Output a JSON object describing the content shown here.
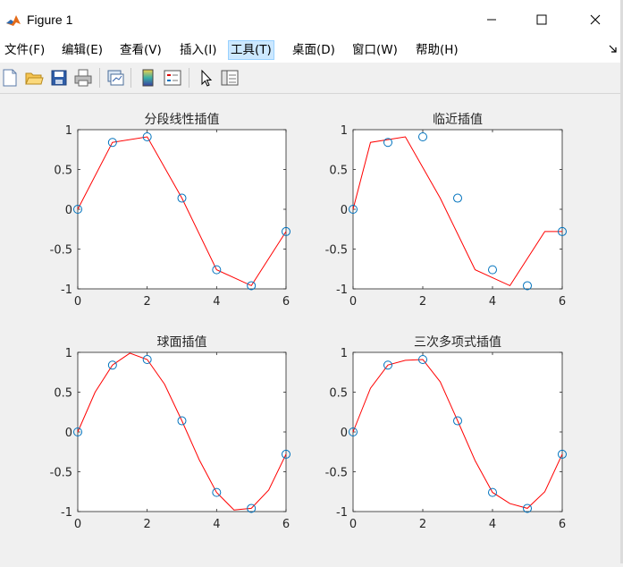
{
  "window": {
    "title": "Figure 1"
  },
  "menu": [
    {
      "label": "文件(F)"
    },
    {
      "label": "编辑(E)"
    },
    {
      "label": "查看(V)"
    },
    {
      "label": "插入(I)"
    },
    {
      "label": "工具(T)"
    },
    {
      "label": "桌面(D)"
    },
    {
      "label": "窗口(W)"
    },
    {
      "label": "帮助(H)"
    }
  ],
  "toolbar": [
    "new-figure-icon",
    "open-file-icon",
    "save-icon",
    "print-icon",
    "link-plot-icon",
    "colorbar-icon",
    "legend-icon",
    "select-pointer-icon",
    "property-inspector-icon"
  ],
  "colors": {
    "line": "#ff0000",
    "marker": "#0072bd",
    "axis": "#262626"
  },
  "chart_data": [
    {
      "type": "line",
      "title": "分段线性插值",
      "xlim": [
        0,
        6
      ],
      "ylim": [
        -1,
        1
      ],
      "xticks": [
        "0",
        "2",
        "4",
        "6"
      ],
      "yticks": [
        "1",
        "0.5",
        "0",
        "-0.5",
        "-1"
      ],
      "markers": {
        "x": [
          0,
          1,
          2,
          3,
          4,
          5,
          6
        ],
        "y": [
          0,
          0.84,
          0.91,
          0.14,
          -0.76,
          -0.96,
          -0.28
        ]
      },
      "line": {
        "x": [
          0,
          1,
          2,
          3,
          4,
          5,
          6
        ],
        "y": [
          0,
          0.84,
          0.91,
          0.14,
          -0.76,
          -0.96,
          -0.28
        ]
      }
    },
    {
      "type": "line",
      "title": "临近插值",
      "xlim": [
        0,
        6
      ],
      "ylim": [
        -1,
        1
      ],
      "xticks": [
        "0",
        "2",
        "4",
        "6"
      ],
      "yticks": [
        "1",
        "0.5",
        "0",
        "-0.5",
        "-1"
      ],
      "markers": {
        "x": [
          0,
          1,
          2,
          3,
          4,
          5,
          6
        ],
        "y": [
          0,
          0.84,
          0.91,
          0.14,
          -0.76,
          -0.96,
          -0.28
        ]
      },
      "line": {
        "x": [
          0,
          0.5,
          1.5,
          2.5,
          3.5,
          4.5,
          5.5,
          6
        ],
        "y": [
          0,
          0.84,
          0.91,
          0.14,
          -0.76,
          -0.96,
          -0.28,
          -0.28
        ]
      }
    },
    {
      "type": "line",
      "title": "球面插值",
      "xlim": [
        0,
        6
      ],
      "ylim": [
        -1,
        1
      ],
      "xticks": [
        "0",
        "2",
        "4",
        "6"
      ],
      "yticks": [
        "1",
        "0.5",
        "0",
        "-0.5",
        "-1"
      ],
      "markers": {
        "x": [
          0,
          1,
          2,
          3,
          4,
          5,
          6
        ],
        "y": [
          0,
          0.84,
          0.91,
          0.14,
          -0.76,
          -0.96,
          -0.28
        ]
      },
      "line": {
        "x": [
          0,
          0.5,
          1,
          1.5,
          2,
          2.5,
          3,
          3.5,
          4,
          4.5,
          5,
          5.5,
          6
        ],
        "y": [
          0,
          0.5,
          0.84,
          0.99,
          0.91,
          0.6,
          0.14,
          -0.35,
          -0.76,
          -0.98,
          -0.96,
          -0.73,
          -0.28
        ]
      }
    },
    {
      "type": "line",
      "title": "三次多项式插值",
      "xlim": [
        0,
        6
      ],
      "ylim": [
        -1,
        1
      ],
      "xticks": [
        "0",
        "2",
        "4",
        "6"
      ],
      "yticks": [
        "1",
        "0.5",
        "0",
        "-0.5",
        "-1"
      ],
      "markers": {
        "x": [
          0,
          1,
          2,
          3,
          4,
          5,
          6
        ],
        "y": [
          0,
          0.84,
          0.91,
          0.14,
          -0.76,
          -0.96,
          -0.28
        ]
      },
      "line": {
        "x": [
          0,
          0.5,
          1,
          1.5,
          2,
          2.5,
          3,
          3.5,
          4,
          4.5,
          5,
          5.5,
          6
        ],
        "y": [
          0,
          0.55,
          0.84,
          0.9,
          0.91,
          0.63,
          0.14,
          -0.36,
          -0.76,
          -0.9,
          -0.96,
          -0.75,
          -0.28
        ]
      }
    }
  ]
}
